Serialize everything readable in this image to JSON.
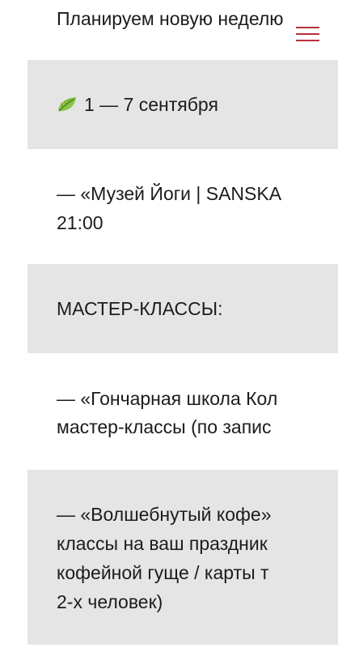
{
  "header": {
    "title": "Планируем новую неделю",
    "menu_icon": "hamburger-menu-icon",
    "accent": "#b5323d"
  },
  "sections": {
    "dates": {
      "icon": "leaf-icon",
      "text": "1 — 7 сентября"
    },
    "museum": {
      "line1": "— «Музей Йоги | SANSKA",
      "line2": "21:00"
    },
    "masterclasses_heading": "МАСТЕР-КЛАССЫ:",
    "pottery": {
      "line1": "— «Гончарная школа Кол",
      "line2": "мастер-классы (по запис"
    },
    "coffee": {
      "line1": "— «Волшебнутый кофе»",
      "line2": "классы на ваш праздник",
      "line3": "кофейной гуще / карты т",
      "line4": "2-х человек)"
    }
  },
  "colors": {
    "shade": "#e5e5e5",
    "text": "#1c1c1c"
  }
}
